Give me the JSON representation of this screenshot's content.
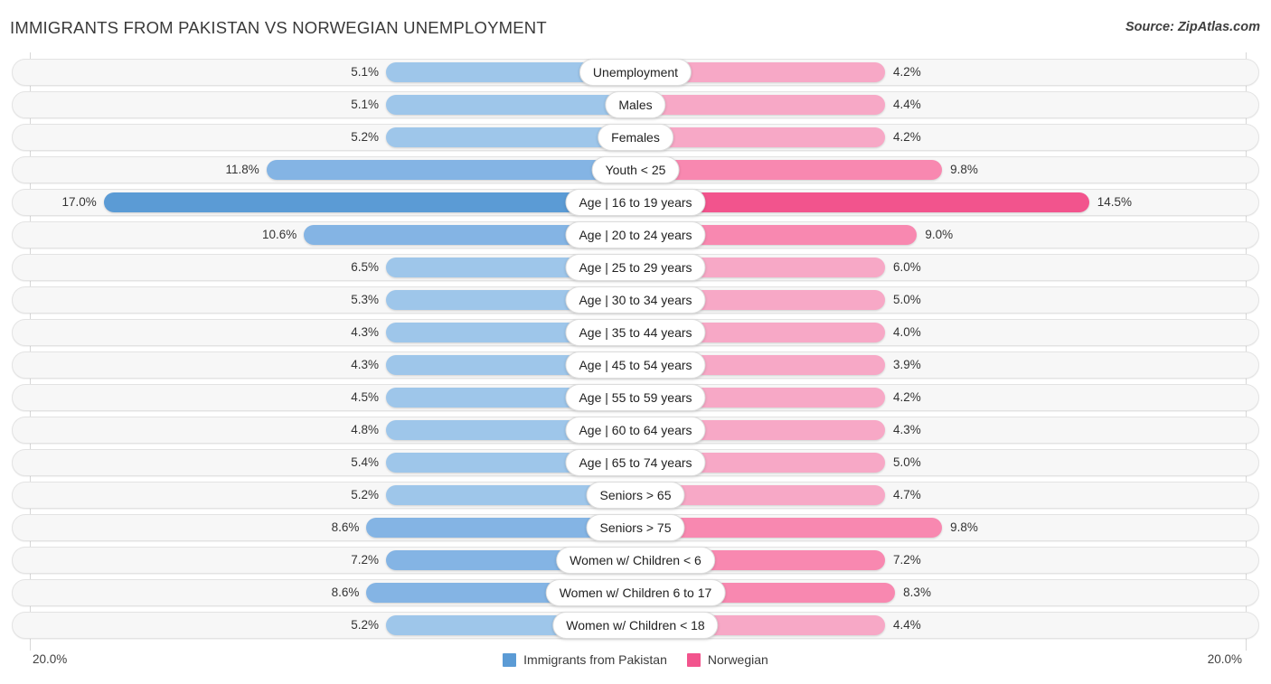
{
  "header": {
    "title": "IMMIGRANTS FROM PAKISTAN VS NORWEGIAN UNEMPLOYMENT",
    "source": "Source: ZipAtlas.com"
  },
  "axis": {
    "left_label": "20.0%",
    "right_label": "20.0%",
    "max": 20.0
  },
  "legend": [
    {
      "label": "Immigrants from Pakistan",
      "color": "#5b9bd5"
    },
    {
      "label": "Norwegian",
      "color": "#f2548d"
    }
  ],
  "colors": {
    "left_light": "#9ec6ea",
    "left_mid": "#84b4e4",
    "left_dark": "#5b9bd5",
    "right_light": "#f7a8c6",
    "right_mid": "#f888b0",
    "right_dark": "#f2548d",
    "track": "#f7f7f7",
    "gridline": "#d8d8d8"
  },
  "chart_data": {
    "type": "bar",
    "title": "IMMIGRANTS FROM PAKISTAN VS NORWEGIAN UNEMPLOYMENT",
    "orientation": "horizontal-diverging",
    "xlabel": "",
    "ylabel": "",
    "xlim": [
      20.0,
      20.0
    ],
    "grid": true,
    "legend_position": "bottom-center",
    "categories": [
      "Unemployment",
      "Males",
      "Females",
      "Youth < 25",
      "Age | 16 to 19 years",
      "Age | 20 to 24 years",
      "Age | 25 to 29 years",
      "Age | 30 to 34 years",
      "Age | 35 to 44 years",
      "Age | 45 to 54 years",
      "Age | 55 to 59 years",
      "Age | 60 to 64 years",
      "Age | 65 to 74 years",
      "Seniors > 65",
      "Seniors > 75",
      "Women w/ Children < 6",
      "Women w/ Children 6 to 17",
      "Women w/ Children < 18"
    ],
    "series": [
      {
        "name": "Immigrants from Pakistan",
        "values": [
          5.1,
          5.1,
          5.2,
          11.8,
          17.0,
          10.6,
          6.5,
          5.3,
          4.3,
          4.3,
          4.5,
          4.8,
          5.4,
          5.2,
          8.6,
          7.2,
          8.6,
          5.2
        ],
        "labels": [
          "5.1%",
          "5.1%",
          "5.2%",
          "11.8%",
          "17.0%",
          "10.6%",
          "6.5%",
          "5.3%",
          "4.3%",
          "4.3%",
          "4.5%",
          "4.8%",
          "5.4%",
          "5.2%",
          "8.6%",
          "7.2%",
          "8.6%",
          "5.2%"
        ]
      },
      {
        "name": "Norwegian",
        "values": [
          4.2,
          4.4,
          4.2,
          9.8,
          14.5,
          9.0,
          6.0,
          5.0,
          4.0,
          3.9,
          4.2,
          4.3,
          5.0,
          4.7,
          9.8,
          7.2,
          8.3,
          4.4
        ],
        "labels": [
          "4.2%",
          "4.4%",
          "4.2%",
          "9.8%",
          "14.5%",
          "9.0%",
          "6.0%",
          "5.0%",
          "4.0%",
          "3.9%",
          "4.2%",
          "4.3%",
          "5.0%",
          "4.7%",
          "9.8%",
          "7.2%",
          "8.3%",
          "4.4%"
        ]
      }
    ]
  }
}
